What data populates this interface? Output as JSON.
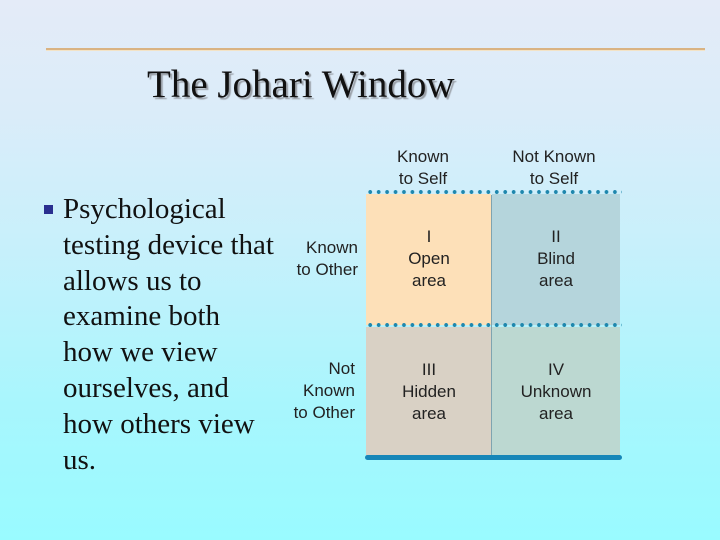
{
  "slide": {
    "title": "The Johari Window",
    "bullet": {
      "icon": "square-bullet-icon",
      "text": "Psychological\ntesting device that\nallows us to\nexamine both\nhow we view\nourselves, and\nhow others view\nus."
    }
  },
  "johari": {
    "column_headers": [
      "Known\nto Self",
      "Not Known\nto Self"
    ],
    "row_headers": [
      "Known\nto Other",
      "Not\nKnown\nto Other"
    ],
    "cells": [
      {
        "numeral": "I",
        "name": "Open",
        "suffix": "area",
        "color": "#fde0b8"
      },
      {
        "numeral": "II",
        "name": "Blind",
        "suffix": "area",
        "color": "#b5d5dc"
      },
      {
        "numeral": "III",
        "name": "Hidden",
        "suffix": "area",
        "color": "#d9d1c5"
      },
      {
        "numeral": "IV",
        "name": "Unknown",
        "suffix": "area",
        "color": "#bcd8d1"
      }
    ],
    "line_color": "#1f87ad"
  }
}
